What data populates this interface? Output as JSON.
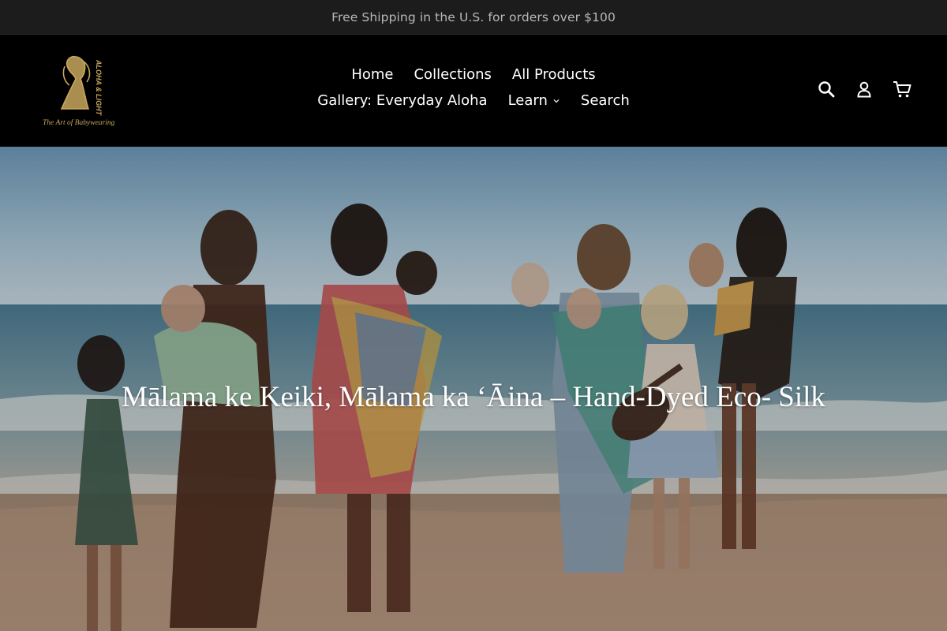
{
  "announcement": {
    "text": "Free Shipping in the U.S. for orders over $100"
  },
  "brand": {
    "logo_vertical_text": "ALOHA & LIGHT",
    "logo_tagline": "The Art of Babywearing",
    "logo_color": "#c8a75e"
  },
  "nav": {
    "row1": [
      {
        "label": "Home"
      },
      {
        "label": "Collections"
      },
      {
        "label": "All Products"
      }
    ],
    "row2": [
      {
        "label": "Gallery: Everyday Aloha"
      },
      {
        "label": "Learn"
      },
      {
        "label": "Search"
      }
    ]
  },
  "header_icons": [
    "search-icon",
    "account-icon",
    "cart-icon"
  ],
  "hero": {
    "title": "Mālama ke Keiki, Mālama ka ʻĀina – Hand-Dyed Eco- Silk"
  },
  "colors": {
    "announcement_bg": "#1c1c1c",
    "header_bg": "#000000",
    "text_light": "#ffffff"
  }
}
